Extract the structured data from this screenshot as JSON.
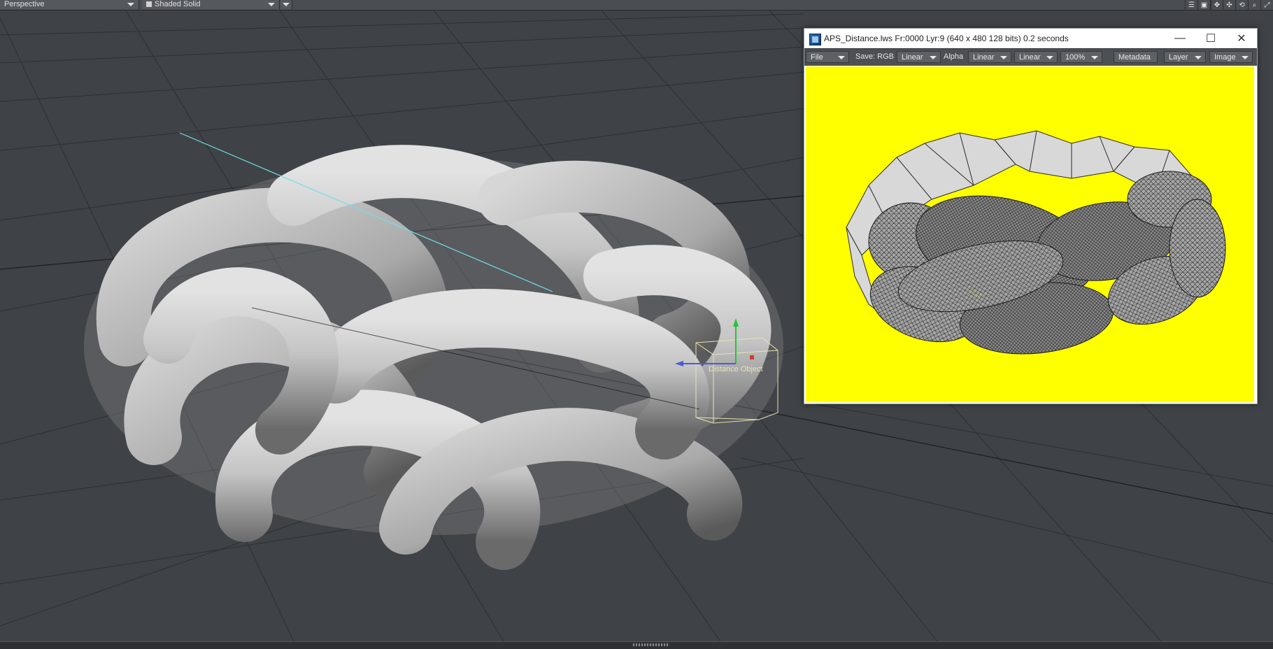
{
  "viewport": {
    "view_mode": "Perspective",
    "shading_mode": "Shaded Solid",
    "object_label": "Distance Object",
    "header_icons": [
      "list-icon",
      "display-options-icon",
      "move-icon",
      "pan-icon",
      "rotate-icon",
      "zoom-icon",
      "maximize-icon"
    ]
  },
  "render_window": {
    "title": "APS_Distance.lws Fr:0000 Lyr:9  (640 x 480 128 bits) 0.2 seconds",
    "buttons": {
      "minimize": "—",
      "maximize": "☐",
      "close": "✕"
    },
    "toolbar": {
      "file": "File",
      "save_label": "Save: RGB",
      "rgb_colorspace": "Linear",
      "alpha_label": "Alpha",
      "alpha_colorspace": "Linear",
      "display_colorspace": "Linear",
      "zoom": "100%",
      "metadata": "Metadata",
      "layer": "Layer",
      "image": "Image"
    },
    "image_background": "#ffff00"
  },
  "colors": {
    "viewport_bg": "#3f4347",
    "grid": "#2b2e31",
    "object": "#c8c8c8",
    "axis_light": "#6fe0ea",
    "bbox": "#e8e2b0"
  }
}
